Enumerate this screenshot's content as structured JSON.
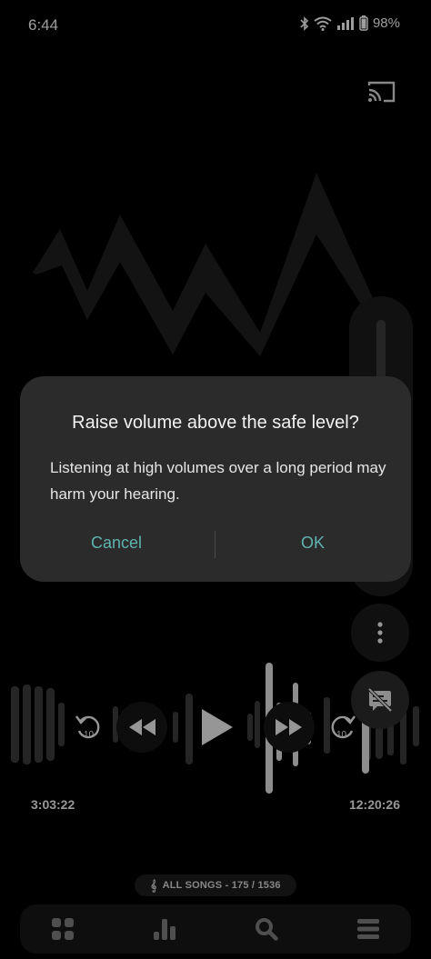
{
  "status": {
    "time": "6:44",
    "battery": "98%",
    "icons": [
      "bluetooth-icon",
      "wifi-icon",
      "signal-icon",
      "battery-icon"
    ]
  },
  "player": {
    "elapsed": "3:03:22",
    "total": "12:20:26",
    "rewind_seconds": "10",
    "forward_seconds": "10",
    "library_label": "ALL SONGS - 175 / 1536"
  },
  "dialog": {
    "title": "Raise volume above the safe level?",
    "body": "Listening at high volumes over a long period may harm your hearing.",
    "cancel_label": "Cancel",
    "ok_label": "OK"
  },
  "colors": {
    "background": "#000000",
    "dialog": "#2b2b2b",
    "accent": "#5fb3b0"
  }
}
